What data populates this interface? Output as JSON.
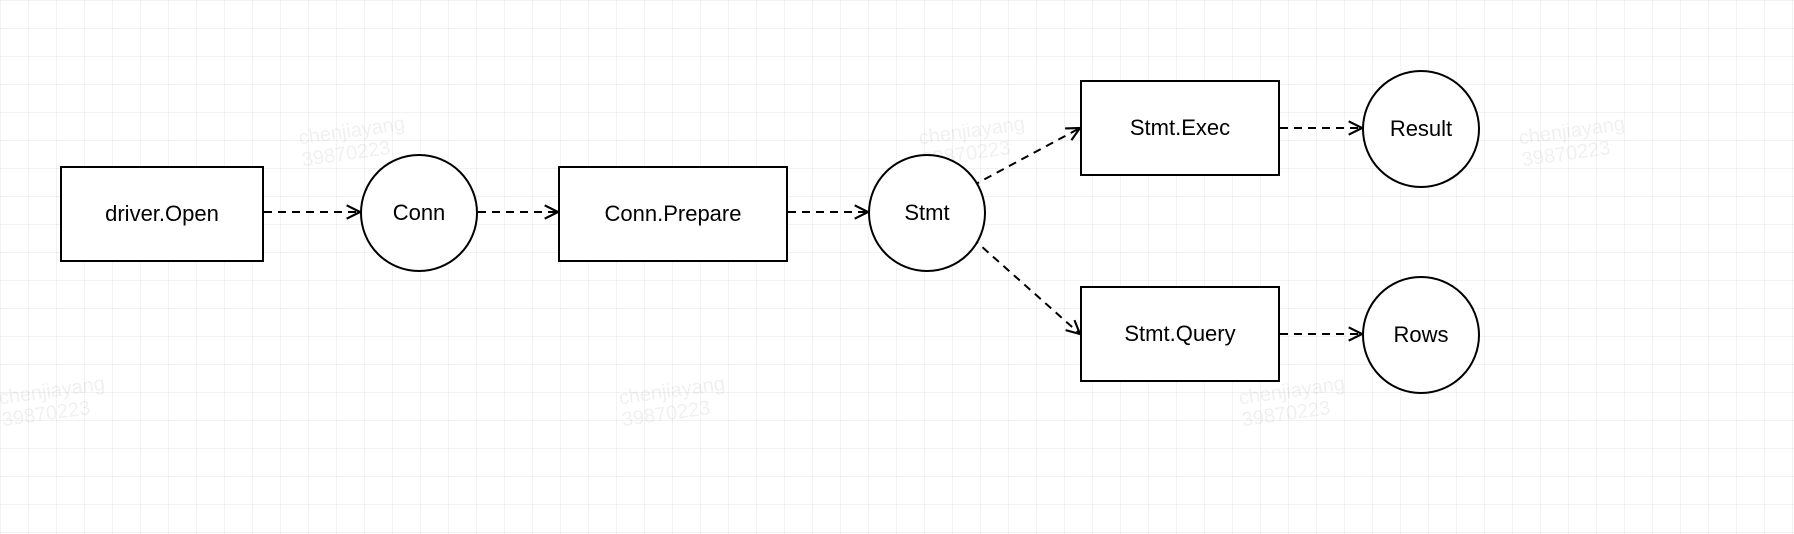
{
  "diagram": {
    "nodes": {
      "driverOpen": {
        "label": "driver.Open",
        "shape": "rect"
      },
      "conn": {
        "label": "Conn",
        "shape": "circle"
      },
      "connPrepare": {
        "label": "Conn.Prepare",
        "shape": "rect"
      },
      "stmt": {
        "label": "Stmt",
        "shape": "circle"
      },
      "stmtExec": {
        "label": "Stmt.Exec",
        "shape": "rect"
      },
      "stmtQuery": {
        "label": "Stmt.Query",
        "shape": "rect"
      },
      "result": {
        "label": "Result",
        "shape": "circle"
      },
      "rows": {
        "label": "Rows",
        "shape": "circle"
      }
    },
    "edges": [
      {
        "from": "driverOpen",
        "to": "conn",
        "style": "dashed-arrow"
      },
      {
        "from": "conn",
        "to": "connPrepare",
        "style": "dashed-arrow"
      },
      {
        "from": "connPrepare",
        "to": "stmt",
        "style": "dashed-arrow"
      },
      {
        "from": "stmt",
        "to": "stmtExec",
        "style": "dashed-arrow"
      },
      {
        "from": "stmt",
        "to": "stmtQuery",
        "style": "dashed-arrow"
      },
      {
        "from": "stmtExec",
        "to": "result",
        "style": "dashed-arrow"
      },
      {
        "from": "stmtQuery",
        "to": "rows",
        "style": "dashed-arrow"
      }
    ],
    "watermark": "chenjiayang\n39870223"
  }
}
